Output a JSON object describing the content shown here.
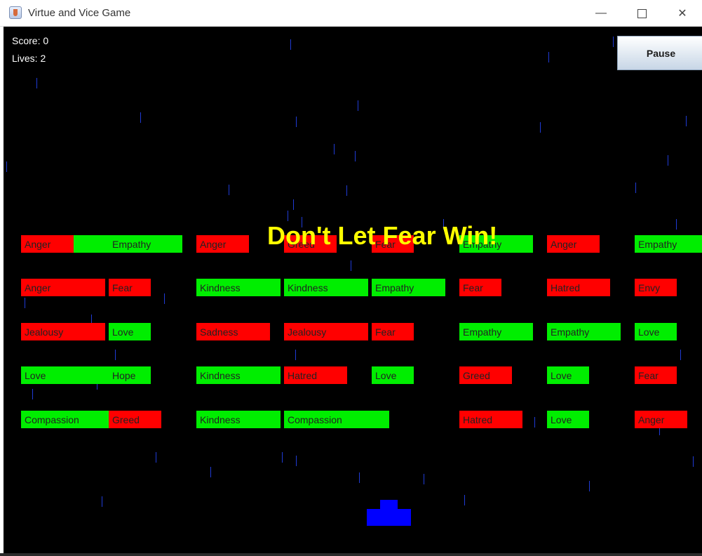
{
  "window": {
    "title": "Virtue and Vice Game",
    "minimize_glyph": "—",
    "close_glyph": "✕"
  },
  "hud": {
    "score": "Score: 0",
    "lives": "Lives: 2"
  },
  "pause_label": "Pause",
  "banner": "Don't Let Fear Win!",
  "colors": {
    "vice": "#ff0000",
    "virtue": "#00ee00",
    "banner": "#ffff00",
    "paddle": "#0000ff",
    "rain": "#1f3bd6"
  },
  "bricks": [
    {
      "label": "Anger",
      "kind": "vice"
    },
    {
      "label": "Empathy",
      "kind": "virtue"
    },
    {
      "label": "Anger",
      "kind": "vice"
    },
    {
      "label": "Greed",
      "kind": "vice"
    },
    {
      "label": "Fear",
      "kind": "vice"
    },
    {
      "label": "Empathy",
      "kind": "virtue"
    },
    {
      "label": "Anger",
      "kind": "vice"
    },
    {
      "label": "Empathy",
      "kind": "virtue"
    },
    {
      "label": "Anger",
      "kind": "vice"
    },
    {
      "label": "Fear",
      "kind": "vice"
    },
    {
      "label": "Kindness",
      "kind": "virtue"
    },
    {
      "label": "Kindness",
      "kind": "virtue"
    },
    {
      "label": "Empathy",
      "kind": "virtue"
    },
    {
      "label": "Fear",
      "kind": "vice"
    },
    {
      "label": "Hatred",
      "kind": "vice"
    },
    {
      "label": "Envy",
      "kind": "vice"
    },
    {
      "label": "Jealousy",
      "kind": "vice"
    },
    {
      "label": "Love",
      "kind": "virtue"
    },
    {
      "label": "Sadness",
      "kind": "vice"
    },
    {
      "label": "Jealousy",
      "kind": "vice"
    },
    {
      "label": "Fear",
      "kind": "vice"
    },
    {
      "label": "Empathy",
      "kind": "virtue"
    },
    {
      "label": "Empathy",
      "kind": "virtue"
    },
    {
      "label": "Love",
      "kind": "virtue"
    },
    {
      "label": "Love",
      "kind": "virtue"
    },
    {
      "label": "Hope",
      "kind": "virtue"
    },
    {
      "label": "Kindness",
      "kind": "virtue"
    },
    {
      "label": "Hatred",
      "kind": "vice"
    },
    {
      "label": "Love",
      "kind": "virtue"
    },
    {
      "label": "Greed",
      "kind": "vice"
    },
    {
      "label": "Love",
      "kind": "virtue"
    },
    {
      "label": "Fear",
      "kind": "vice"
    },
    {
      "label": "Compassion",
      "kind": "virtue"
    },
    {
      "label": "Greed",
      "kind": "vice"
    },
    {
      "label": "Kindness",
      "kind": "virtue"
    },
    {
      "label": "Compassion",
      "kind": "virtue"
    },
    {
      "label": "Hatred",
      "kind": "vice"
    },
    {
      "label": "Love",
      "kind": "virtue"
    },
    {
      "label": "Anger",
      "kind": "vice"
    }
  ]
}
